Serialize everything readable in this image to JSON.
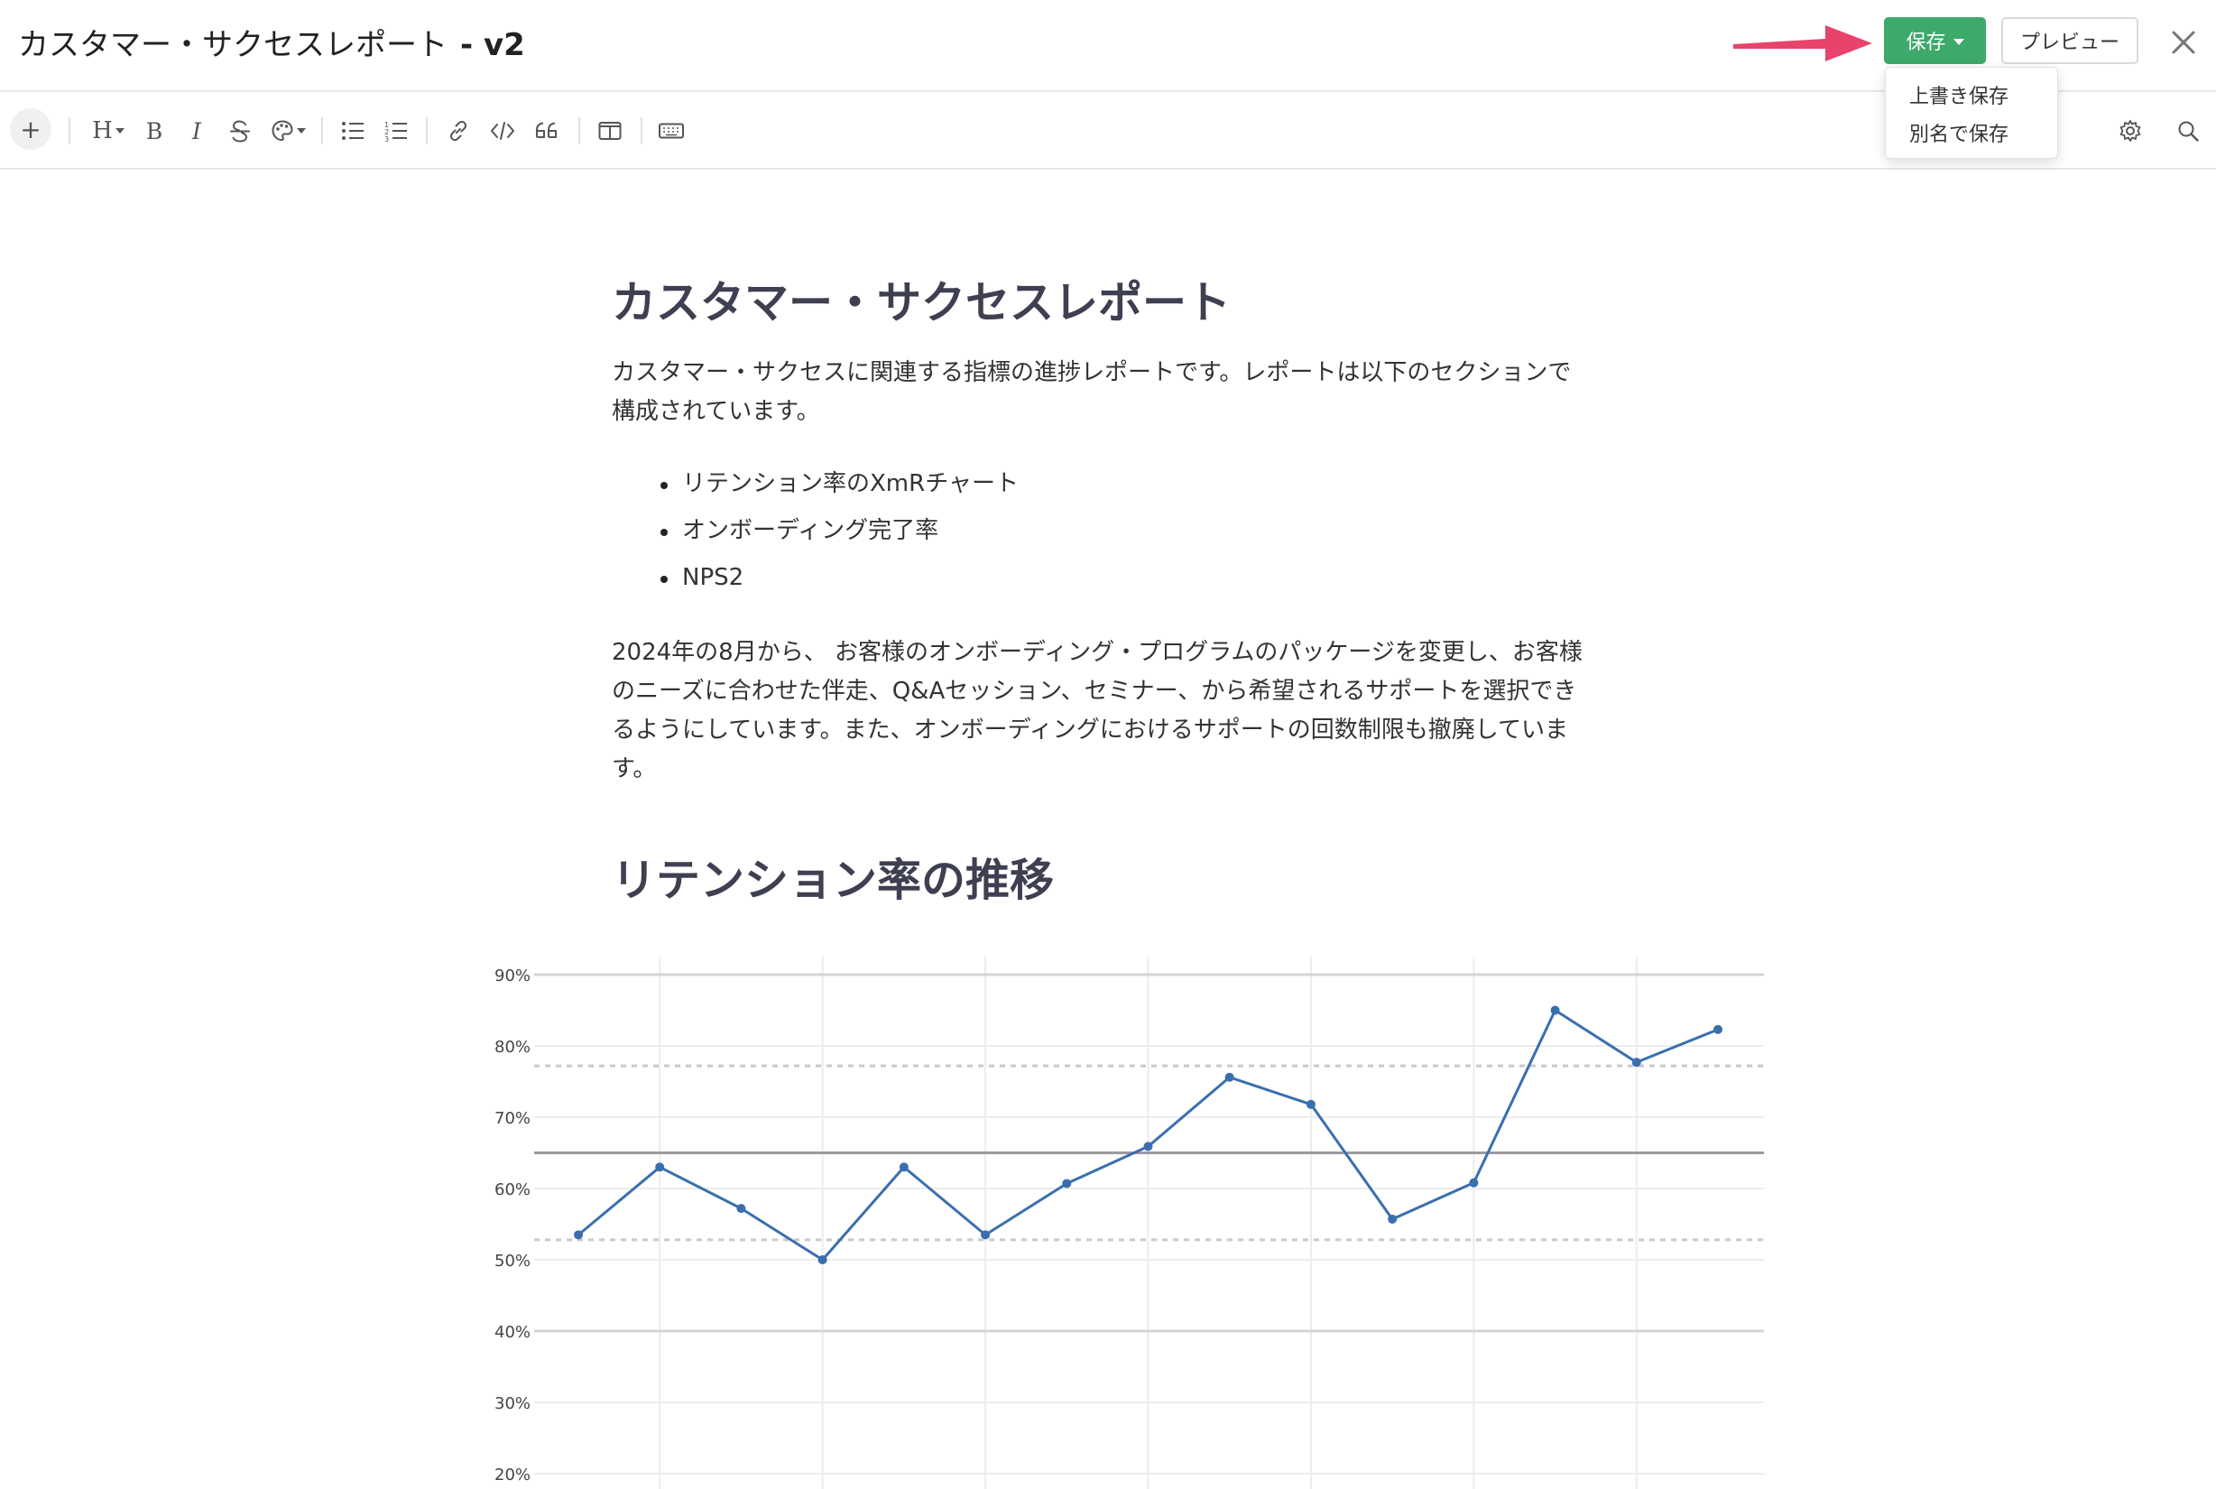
{
  "header": {
    "title": "カスタマー・サクセスレポート",
    "version": "- v2",
    "save_label": "保存",
    "preview_label": "プレビュー"
  },
  "save_menu": {
    "items": [
      "上書き保存",
      "別名で保存"
    ]
  },
  "toolbar": {
    "add_label": "+",
    "heading_label": "H",
    "bold_label": "B",
    "italic_label": "I"
  },
  "document": {
    "title": "カスタマー・サクセスレポート",
    "intro_line1": "カスタマー・サクセスに関連する指標の進捗レポートです。レポートは以下のセクションで",
    "intro_line2": "構成されています。",
    "sections": [
      "リテンション率のXmRチャート",
      "オンボーディング完了率",
      "NPS2"
    ],
    "body_line1": "2024年の8月から、 お客様のオンボーディング・プログラムのパッケージを変更し、お客様",
    "body_line2": "のニーズに合わせた伴走、Q&Aセッション、セミナー、から希望されるサポートを選択でき",
    "body_line3": "るようにしています。また、オンボーディングにおけるサポートの回数制限も撤廃していま",
    "body_line4": "す。",
    "section_heading": "リテンション率の推移"
  },
  "colors": {
    "accent_green": "#3ea96b",
    "arrow": "#e8436b",
    "line": "#3a6fae"
  },
  "chart_data": {
    "type": "line",
    "title": "",
    "xlabel": "",
    "ylabel": "",
    "ylim": [
      20,
      90
    ],
    "yticks": [
      "90%",
      "80%",
      "70%",
      "60%",
      "50%",
      "40%",
      "30%",
      "20%"
    ],
    "series": [
      {
        "values": [
          53.5,
          63,
          57.2,
          50,
          63,
          53.5,
          60.7,
          65.9,
          75.6,
          71.8,
          55.7,
          60.8,
          85,
          77.7,
          82.3
        ]
      }
    ],
    "center_line": 65,
    "upper_limit": 77.2,
    "lower_limit": 52.8,
    "grid": true
  }
}
